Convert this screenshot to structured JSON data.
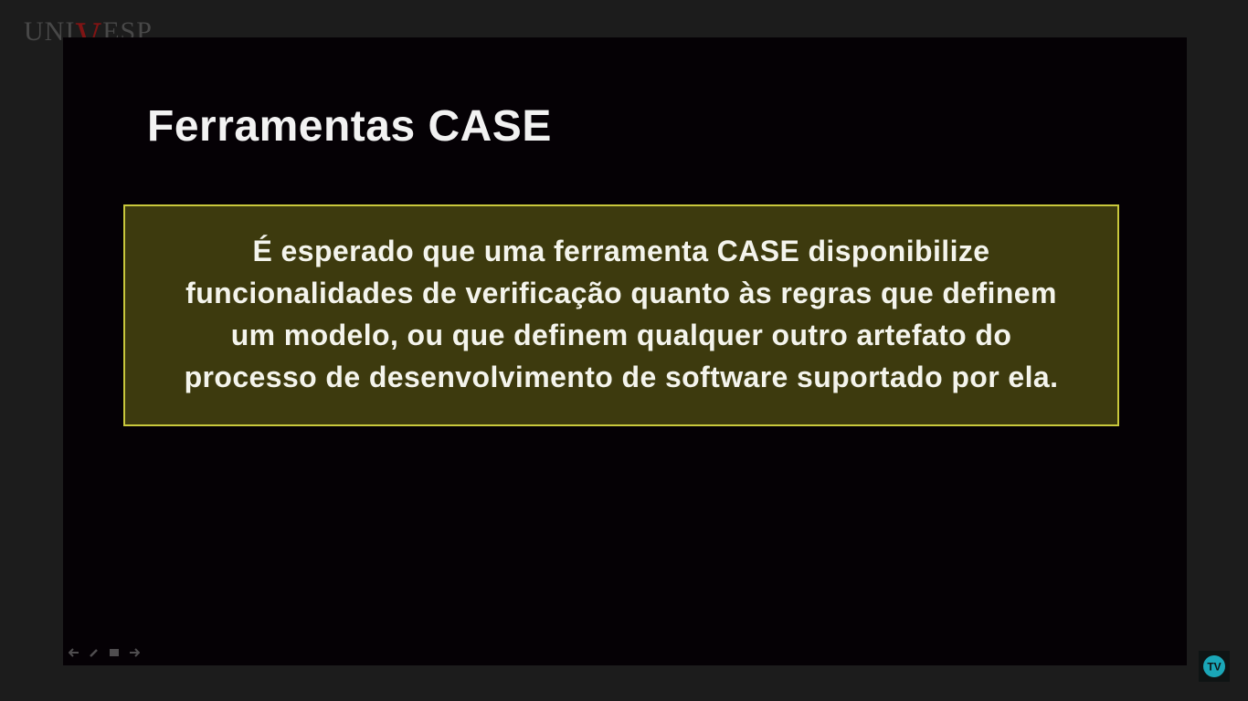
{
  "logo": {
    "prefix": "UNI",
    "v_letter": "V",
    "suffix": "ESP",
    "accent_color": "#8a1414"
  },
  "slide": {
    "title": "Ferramentas CASE",
    "callout_text": "É esperado que uma ferramenta CASE disponibilize funcionalidades de verificação quanto às regras que definem um modelo, ou que definem qualquer outro artefato do processo de desenvolvimento de software suportado por ela.",
    "callout_background": "#3d3a0e",
    "callout_border": "#c9c83c"
  },
  "player_controls": {
    "icons": [
      "arrow-left-icon",
      "pen-icon",
      "menu-icon",
      "arrow-right-icon"
    ]
  },
  "tv_badge": {
    "icon": "tv-logo-icon",
    "color": "#1aa7b8"
  }
}
